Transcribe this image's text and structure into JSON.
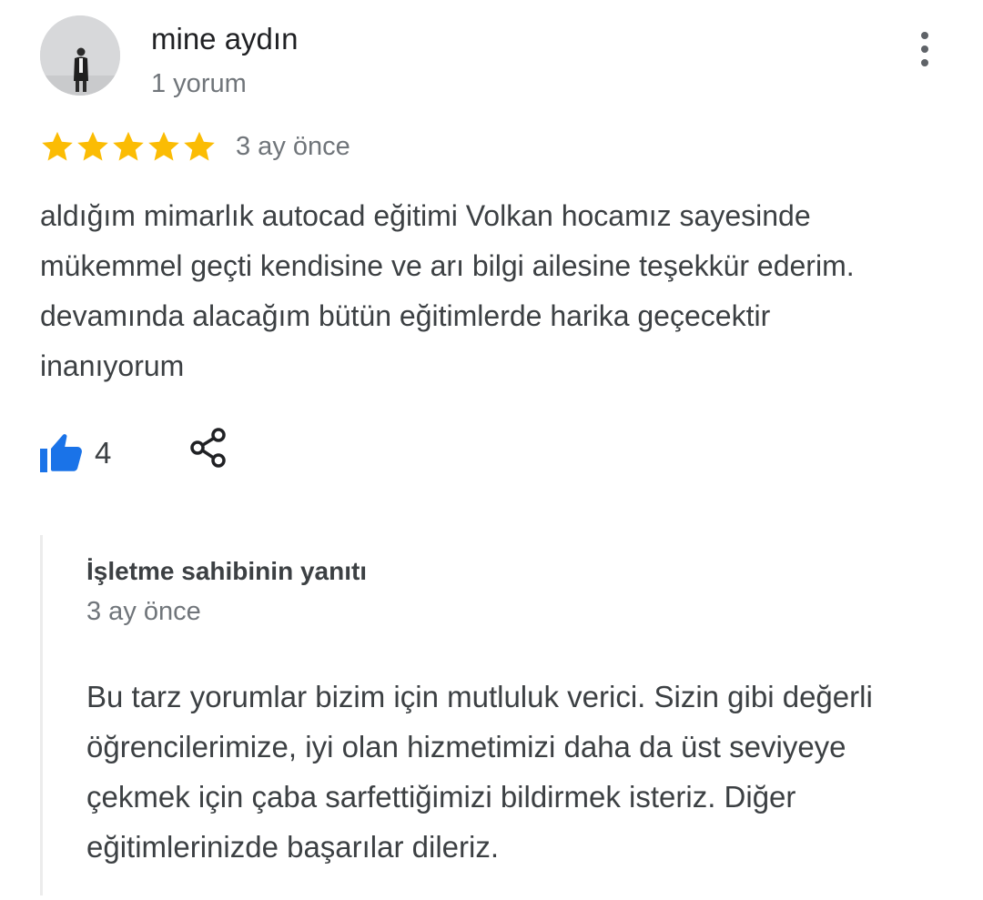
{
  "review": {
    "author": {
      "name": "mine aydın",
      "meta": "1 yorum"
    },
    "rating": 5,
    "rating_max": 5,
    "time": "3 ay önce",
    "text": "aldığım mimarlık autocad eğitimi Volkan hocamız sayesinde mükemmel geçti kendisine ve arı bilgi ailesine teşekkür ederim. devamında alacağım bütün eğitimlerde harika geçecektir inanıyorum",
    "likes": "4",
    "icons": {
      "more": "more-vert-icon",
      "like": "thumb-up-icon",
      "share": "share-icon",
      "star": "star-icon"
    }
  },
  "owner_reply": {
    "title": "İşletme sahibinin yanıtı",
    "time": "3 ay önce",
    "text": "Bu tarz yorumlar bizim için mutluluk verici. Sizin gibi değerli öğrencilerimize, iyi olan hizmetimizi daha da üst seviyeye çekmek için çaba sarfettiğimizi bildirmek isteriz. Diğer eğitimlerinizde başarılar dileriz."
  },
  "colors": {
    "star": "#fbbc04",
    "like": "#1a73e8",
    "primary_text": "#202124",
    "secondary_text": "#70757a",
    "body_text": "#3c4043",
    "reply_border": "#ececec"
  }
}
